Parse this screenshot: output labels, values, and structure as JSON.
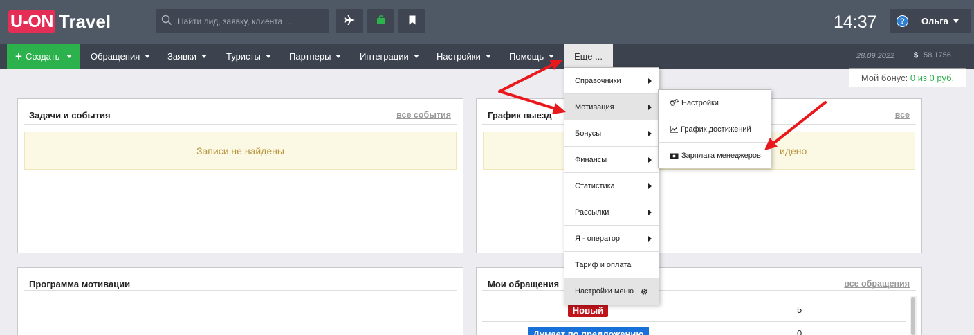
{
  "header": {
    "logo_box": "U-ON",
    "logo_text": "Travel",
    "search_placeholder": "Найти лид, заявку, клиента ...",
    "time": "14:37",
    "user_name": "Ольга",
    "help_glyph": "?"
  },
  "nav": {
    "create_label": "Создать",
    "items": [
      "Обращения",
      "Заявки",
      "Туристы",
      "Партнеры",
      "Интеграции",
      "Настройки",
      "Помощь"
    ],
    "more_label": "Еще ...",
    "date": "28.09.2022",
    "currency_symbol": "$",
    "rate": "58.1756"
  },
  "bonus": {
    "prefix": "Мой бонус: ",
    "value": "0 из 0 руб."
  },
  "panels": {
    "tasks": {
      "title": "Задачи и события",
      "link": "все события",
      "empty": "Записи не найдены"
    },
    "schedule": {
      "title": "График выезд",
      "link": "все",
      "empty": "идено"
    },
    "motivation": {
      "title": "Программа мотивации"
    },
    "requests": {
      "title": "Мои обращения",
      "link": "все обращения",
      "rows": [
        {
          "status": "Новый",
          "count": "5"
        },
        {
          "status": "Думает по предложению",
          "count": "0"
        }
      ]
    }
  },
  "more_menu": [
    {
      "label": "Справочники",
      "submenu": true
    },
    {
      "label": "Мотивация",
      "submenu": true
    },
    {
      "label": "Бонусы",
      "submenu": true
    },
    {
      "label": "Финансы",
      "submenu": true
    },
    {
      "label": "Статистика",
      "submenu": true
    },
    {
      "label": "Рассылки",
      "submenu": true
    },
    {
      "label": "Я - оператор",
      "submenu": true
    },
    {
      "label": "Тариф и оплата",
      "submenu": false
    },
    {
      "label": "Настройки меню",
      "submenu": false
    }
  ],
  "motivation_submenu": [
    {
      "label": "Настройки",
      "icon": "gears-icon"
    },
    {
      "label": "График достижений",
      "icon": "line-chart-icon"
    },
    {
      "label": "Зарплата менеджеров",
      "icon": "money-icon"
    }
  ],
  "colors": {
    "topbar": "#4f5865",
    "navbar": "#3c434e",
    "create": "#2bb24c",
    "logo": "#e52e56",
    "annotation_arrows": "#e8181c"
  }
}
